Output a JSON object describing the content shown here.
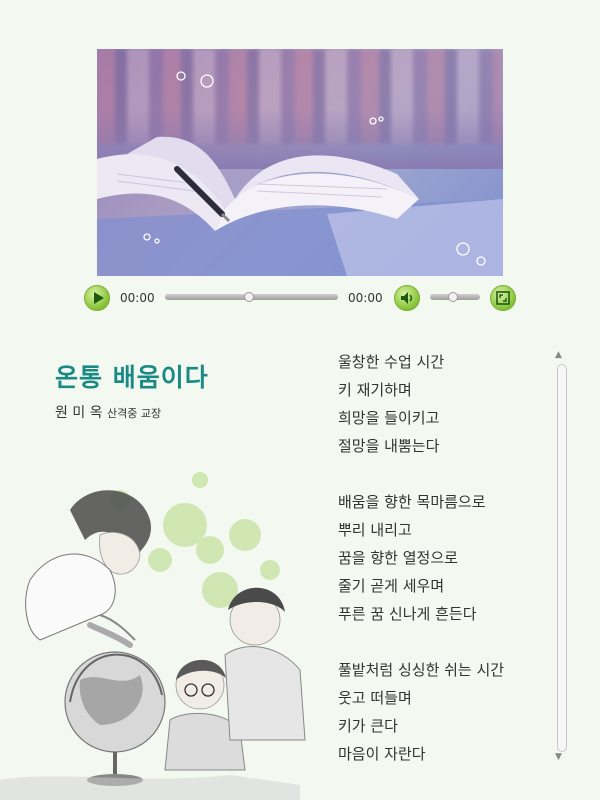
{
  "player": {
    "current_time": "00:00",
    "duration": "00:00",
    "progress": 0.0,
    "buffered_marker": 0.48,
    "volume": 0.4,
    "icons": {
      "play": "play-icon",
      "volume": "speaker-icon",
      "fullscreen": "fullscreen-icon"
    }
  },
  "poem": {
    "title": "온통 배움이다",
    "author_name": "원 미 옥",
    "author_role": "산격중 교장",
    "lines": [
      "울창한 수업 시간",
      "키 재기하며",
      "희망을 들이키고",
      "절망을 내뿜는다",
      "",
      "배움을 향한 목마름으로",
      "뿌리 내리고",
      "꿈을 향한 열정으로",
      "줄기 곧게 세우며",
      "푸른 꿈 신나게 흔든다",
      "",
      "풀밭처럼 싱싱한 쉬는 시간",
      "웃고 떠들며",
      "키가 큰다",
      "마음이 자란다"
    ]
  },
  "colors": {
    "background": "#f3f8f1",
    "title": "#1c8a84",
    "button_green": "#8cc63f"
  }
}
